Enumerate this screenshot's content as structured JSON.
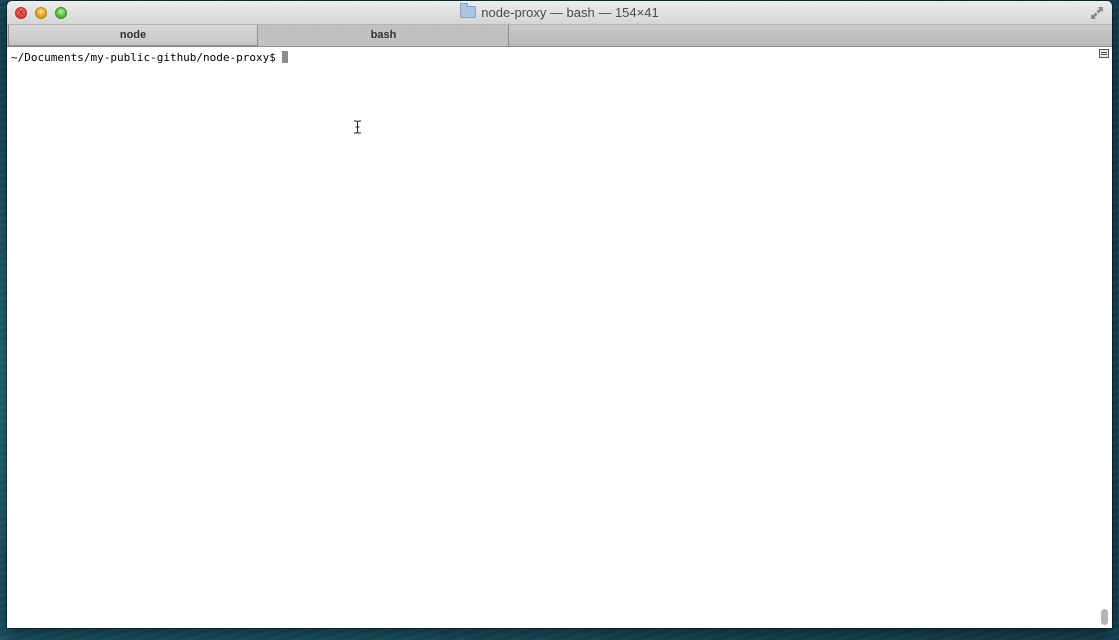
{
  "window": {
    "title": "node-proxy — bash — 154×41"
  },
  "traffic_lights": {
    "close": "×",
    "minimize": "",
    "zoom": ""
  },
  "tabs": [
    {
      "label": "node",
      "active": true
    },
    {
      "label": "bash",
      "active": false
    }
  ],
  "terminal": {
    "prompt": "~/Documents/my-public-github/node-proxy$"
  },
  "icons": {
    "folder": "folder-icon",
    "fullscreen": "fullscreen-icon",
    "split": "split-pane-icon",
    "text_cursor": "ibeam-cursor-icon"
  },
  "colors": {
    "terminal_background": "#ffffff",
    "terminal_text": "#000000",
    "cursor_block": "#8c8c8c"
  }
}
